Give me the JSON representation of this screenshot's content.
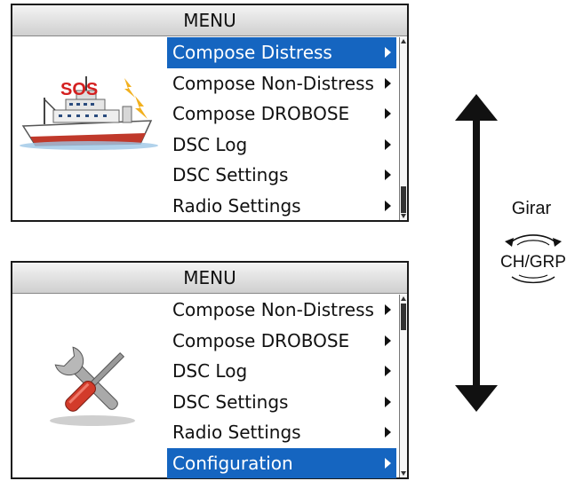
{
  "top_panel": {
    "title": "MENU",
    "sos_label": "SOS",
    "items": [
      {
        "label": "Compose Distress",
        "selected": true
      },
      {
        "label": "Compose Non-Distress",
        "selected": false
      },
      {
        "label": "Compose DROBOSE",
        "selected": false
      },
      {
        "label": "DSC Log",
        "selected": false
      },
      {
        "label": "DSC Settings",
        "selected": false
      },
      {
        "label": "Radio Settings",
        "selected": false
      }
    ]
  },
  "bottom_panel": {
    "title": "MENU",
    "items": [
      {
        "label": "Compose Non-Distress",
        "selected": false
      },
      {
        "label": "Compose DROBOSE",
        "selected": false
      },
      {
        "label": "DSC Log",
        "selected": false
      },
      {
        "label": "DSC Settings",
        "selected": false
      },
      {
        "label": "Radio Settings",
        "selected": false
      },
      {
        "label": "Configuration",
        "selected": true
      }
    ]
  },
  "instruction": {
    "action": "Girar",
    "knob_label": "CH/GRP"
  },
  "colors": {
    "selection": "#1565c0",
    "sos": "#d42020"
  }
}
